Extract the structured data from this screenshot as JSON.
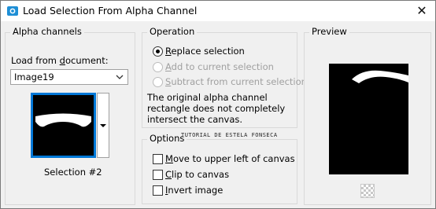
{
  "window": {
    "title": "Load Selection From Alpha Channel",
    "close_glyph": "✕"
  },
  "alpha": {
    "group_title": "Alpha channels",
    "load_label_pre": "Load from ",
    "load_label_u": "d",
    "load_label_post": "ocument:",
    "document_value": "Image19",
    "selection_label": "Selection #2"
  },
  "operation": {
    "group_title": "Operation",
    "options": [
      {
        "u": "R",
        "rest": "eplace selection",
        "selected": true,
        "enabled": true
      },
      {
        "u": "A",
        "rest": "dd to current selection",
        "selected": false,
        "enabled": false
      },
      {
        "u": "S",
        "rest": "ubtract from current selection",
        "selected": false,
        "enabled": false
      }
    ],
    "note_lines": [
      "The original alpha channel",
      "rectangle does not completely",
      "intersect the canvas."
    ]
  },
  "options": {
    "group_title": "Options",
    "checkboxes": [
      {
        "u": "M",
        "rest": "ove to upper left of canvas",
        "checked": false
      },
      {
        "u": "C",
        "rest": "lip to canvas",
        "checked": false
      },
      {
        "u": "I",
        "rest": "nvert image",
        "checked": false
      }
    ]
  },
  "preview": {
    "group_title": "Preview"
  },
  "watermark": "TUTORIAL DE ESTELA FONSECA",
  "colors": {
    "accent": "#0078d7",
    "title_icon": "#1e8fd6"
  },
  "icons": [
    "camera-icon",
    "close-icon",
    "chevron-down-icon",
    "dropdown-arrow-icon",
    "checkerboard-icon"
  ]
}
